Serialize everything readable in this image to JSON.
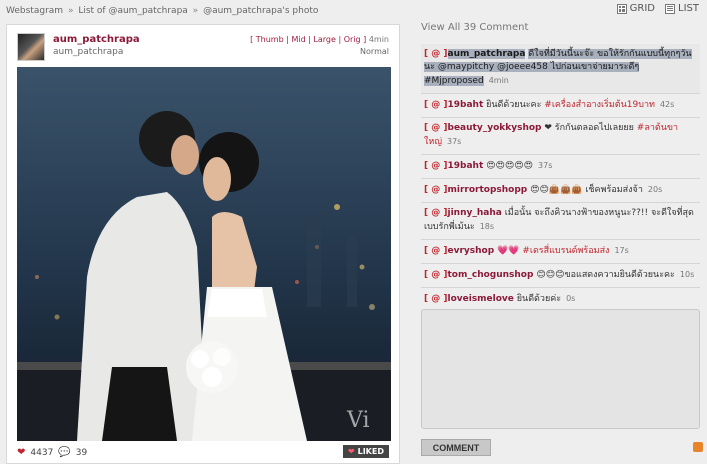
{
  "breadcrumb": [
    "Webstagram",
    "List of @aum_patchrapa",
    "@aum_patchrapa's photo"
  ],
  "breadcrumb_sep": "»",
  "view_toggle": {
    "grid": "GRID",
    "list": "LIST"
  },
  "photo": {
    "username": "aum_patchrapa",
    "fullname": "aum_patchrapa",
    "size_links": "[ Thumb | Mid | Large | Orig ]",
    "time": "4min",
    "filter": "Normal",
    "likes": "4437",
    "comments": "39",
    "liked_label": "LIKED"
  },
  "sidebar": {
    "view_all": "View All 39 Comment",
    "comment_button": "COMMENT"
  },
  "comments": [
    {
      "user": "aum_patchrapa",
      "pre": "ดีใจที่มีวันนี้นะจ๊ะ ขอให้รักกันแบบนี้ทุกๆวันนะ @maypitchy @joeee458 ไปก่อนเขาจ่ายมาระดีๆ",
      "tag": "#Mjproposed",
      "post": "",
      "time": "4min",
      "highlight": true
    },
    {
      "user": "19baht",
      "pre": "ยินดีด้วยนะคะ",
      "tag": "#เครื่องสำอางเริ่มต้น19บาท",
      "post": "",
      "time": "42s"
    },
    {
      "user": "beauty_yokkyshop",
      "pre": "❤ รักกันตลอดไปเลยยย",
      "tag": "#ลาต้นขาใหญ่",
      "post": "",
      "time": "37s"
    },
    {
      "user": "19baht",
      "pre": "😍😍😍😍😍",
      "tag": "",
      "post": "",
      "time": "37s"
    },
    {
      "user": "mirrortopshopp",
      "pre": "😍😊👜👜👜 ",
      "tag": "",
      "post": "เช็คพร้อมส่งจ้า",
      "time": "20s"
    },
    {
      "user": "jinny_haha",
      "pre": "เมื่อนั้น จะถึงคิวนางฟ้าของหนูนะ??!! จะดีใจที่สุดเบบรักพี่เม้นะ",
      "tag": "",
      "post": "",
      "time": "18s"
    },
    {
      "user": "evryshop",
      "pre": "💗💗 ",
      "tag": "#เดรสี่แบรนด์พร้อมส่ง",
      "post": "",
      "time": "17s"
    },
    {
      "user": "tom_chogunshop",
      "pre": "😊😊😊ขอแสดงความยินดีด้วยนะคะ",
      "tag": "",
      "post": "",
      "time": "10s"
    },
    {
      "user": "loveismelove",
      "pre": "ยินดีด้วยค่ะ",
      "tag": "",
      "post": "",
      "time": "0s"
    }
  ]
}
